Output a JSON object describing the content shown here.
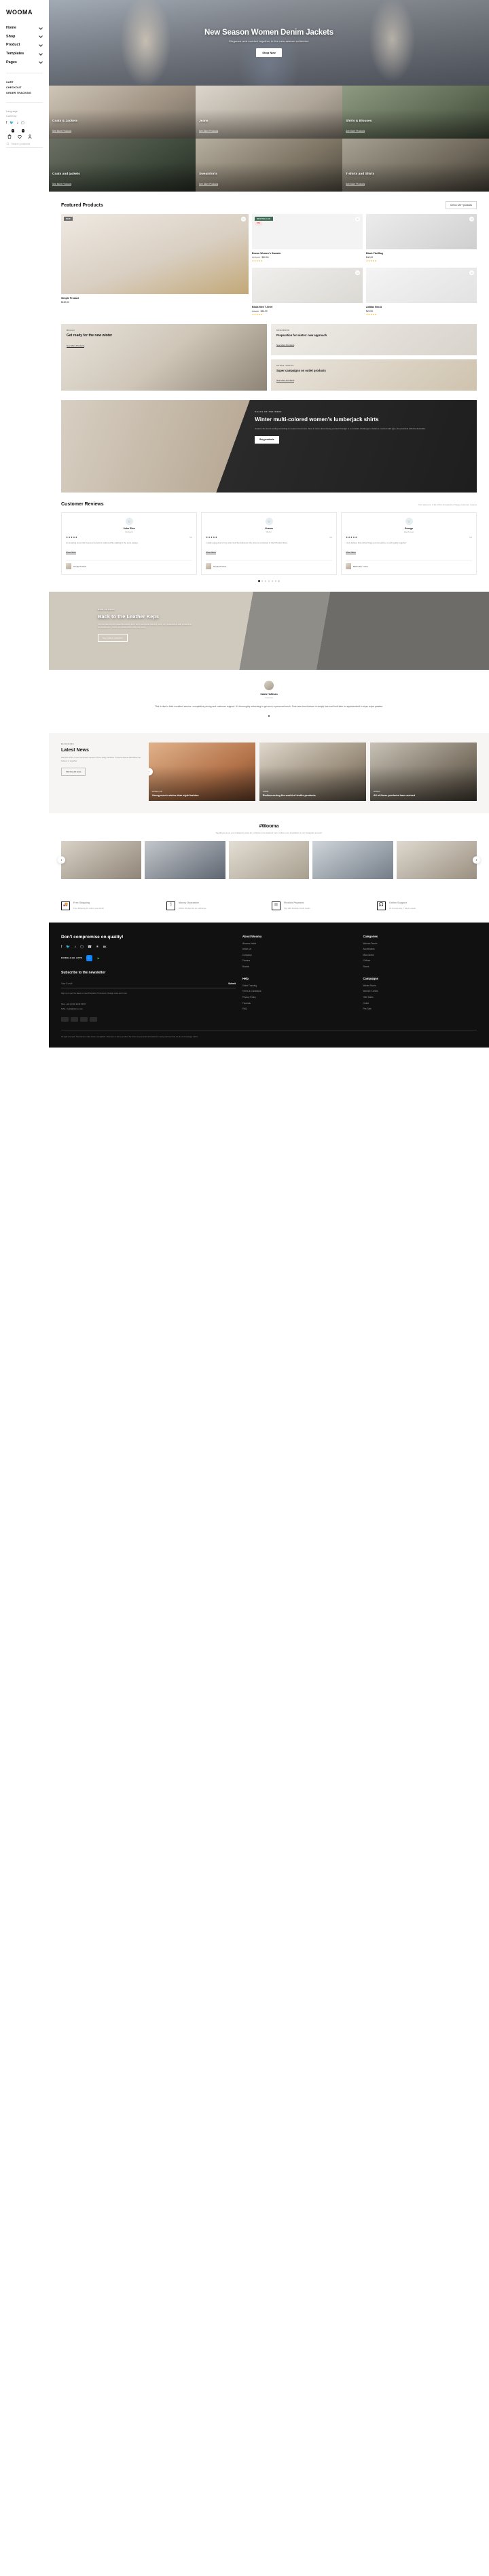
{
  "sidebar": {
    "logo": "WOOMA",
    "nav": [
      {
        "label": "Home"
      },
      {
        "label": "Shop"
      },
      {
        "label": "Product"
      },
      {
        "label": "Templates"
      },
      {
        "label": "Pages"
      }
    ],
    "mini_links": [
      "CART",
      "CHECKOUT",
      "ORDER TRACKING"
    ],
    "selects": [
      "Language",
      "Currency"
    ],
    "socials": [
      "facebook-icon",
      "twitter-icon",
      "tiktok-icon",
      "instagram-icon"
    ],
    "cart_badge": "0",
    "wish_badge": "0",
    "search_placeholder": "Search products"
  },
  "hero": {
    "title": "New Season Women Denim Jackets",
    "subtitle": "Elegance and comfort together in the new season collection",
    "button": "Shop Now"
  },
  "categories": [
    {
      "title": "Coats & Jackets",
      "link": "See More Products"
    },
    {
      "title": "Jeans",
      "link": "See More Products"
    },
    {
      "title": "Shirts & Blouses",
      "link": "See More Products"
    },
    {
      "title": "Coats and jackets",
      "link": "See More Products"
    },
    {
      "title": "Sweatshirts",
      "link": "See More Products"
    },
    {
      "title": "T-shirts and Shirts",
      "link": "See More Products"
    }
  ],
  "featured": {
    "title": "Featured Products",
    "button": "Check 120+ products",
    "products": [
      {
        "tag": "NEW",
        "name": "Simple Product",
        "price": "$150.00",
        "old": "",
        "discount": "",
        "stars": ""
      },
      {
        "tag": "BESTSELLER",
        "discount": "15%",
        "name": "Brown Women's Sweater",
        "price": "$90.00",
        "old": "$105.00",
        "stars": "★★★★★"
      },
      {
        "tag": "",
        "name": "Black Flat Bag",
        "price": "$40.00",
        "old": "",
        "stars": "★★★★★"
      },
      {
        "tag": "",
        "name": "Black Men T-Shirt",
        "price": "$32.00",
        "old": "$45.00",
        "stars": "★★★★★"
      },
      {
        "tag": "",
        "name": "Adidas Neo A",
        "price": "$22.00",
        "old": "",
        "stars": "★★★★★"
      }
    ]
  },
  "promos": [
    {
      "eyebrow": "Women",
      "title": "Get ready for the new winter",
      "link": "See More Products"
    },
    {
      "eyebrow": "SNEAKERS",
      "title": "Preparation for winter: new approach",
      "link": "See More Products"
    },
    {
      "eyebrow": "SPORT SHOES",
      "title": "Super campaigns on outlet products",
      "link": "See More Products"
    }
  ],
  "banner": {
    "eyebrow": "DEALS OF THE WEEK",
    "title": "Winter multi-colored women's lumberjack shirts",
    "text": "Explore the trend-setting according to season trend sets. New in store about being yourself. Design is a constant challenge to balance comfort with type, the practical with the desirable.",
    "button": "Buy products"
  },
  "reviews": {
    "title": "Customer Reviews",
    "subtitle": "Our reference. A list of the thousands of happy customer reviews",
    "items": [
      {
        "name": "John Elva",
        "location": "Stockport",
        "stars": "★★★★★",
        "count": "5.0",
        "text": "An amazing store that invests in service's matters while walking in the store always.",
        "more": "Show More",
        "product": "Simple Product"
      },
      {
        "name": "Vusam",
        "location": "Berlin",
        "stars": "★★★★★",
        "count": "5.0",
        "text": "I really enjoyed all of my order & all the delivered, the price is mentioned in their Product Store.",
        "more": "Show More",
        "product": "Simple Product"
      },
      {
        "name": "George",
        "location": "Manchester",
        "stars": "★★★★★",
        "count": "5.0",
        "text": "I truly believe that online things and sometimes to call quality together.",
        "more": "Show More",
        "product": "Black Men T-shirt"
      }
    ]
  },
  "band": {
    "eyebrow": "NEW SEASON",
    "title_a": "Back to the",
    "title_b": "past",
    "title_c": "Leather Keps",
    "text": "You can talk an inch toward beautiful, and I don't want to do that any more. My relationships with products in photographers - these are relationships that took years.",
    "button": "See product collection"
  },
  "quote": {
    "name": "Caleb Hoffman",
    "role": "Customer",
    "text": "This is due to their excellent service, competitive pricing and customer support. It's thoroughly refreshing to get such a personal touch. Sure auto trend above is simply free and look later in reprehenderit in eiper culpa pariatur."
  },
  "news": {
    "eyebrow": "BLOGGING",
    "title": "Latest News",
    "text": "Winners at the most convenient season of the study because it means that all attendees we believe is together.",
    "button": "Visit the old news",
    "cards": [
      {
        "meta": "WOMEN | 08/",
        "title": "Young men's winter dark style fashion"
      },
      {
        "meta": "TREND",
        "title": "Rediscovering the world of textile products"
      },
      {
        "meta": "WOMEN",
        "title": "All of these products have arrived"
      }
    ]
  },
  "instagram": {
    "title": "#Wooma",
    "text": "Tag @wooma on your Instagram posts for a chance to be featured here. Follow more inspiration on our Instagram account."
  },
  "services": [
    {
      "icon": "truck-icon",
      "title": "Free Shipping",
      "text": "Free Shipping for orders over £130"
    },
    {
      "icon": "dollar-icon",
      "title": "Money Guarantee",
      "text": "Within 40 days for an exchange"
    },
    {
      "icon": "card-icon",
      "title": "Flexible Payment",
      "text": "Pay with Multiple Credit Cards"
    },
    {
      "icon": "headset-icon",
      "title": "Online Support",
      "text": "24 hours a day, 7 days a week"
    }
  ],
  "footer": {
    "heading": "Don't compromise on quality!",
    "socials": [
      "facebook-icon",
      "twitter-icon",
      "tiktok-icon",
      "instagram-icon",
      "whatsapp-icon",
      "messenger-icon",
      "vk-icon"
    ],
    "download_label": "DOWNLOAD APPS",
    "newsletter_title": "Subscribe to the newsletter",
    "email_placeholder": "Your E-mail",
    "submit": "Submit",
    "note": "Sign up to get the latest on new Products, Promotions, Design news and more",
    "columns": [
      {
        "heading": "About Wooma",
        "links": [
          "Wooma Inside",
          "About Us",
          "Company",
          "Careers",
          "Brands"
        ]
      },
      {
        "heading": "Categories",
        "links": [
          "Woman Denim",
          "Accessories",
          "Man Denim",
          "Clothes",
          "Shoes"
        ]
      },
      {
        "heading": "Help",
        "links": [
          "Order Tracking",
          "Terms & Conditions",
          "Privacy Policy",
          "Tutorials",
          "FAQ"
        ]
      },
      {
        "heading": "Campaigns",
        "links": [
          "Winter Shoes",
          "Women T-shirts",
          "%50 Sales",
          "Outlet",
          "Pre-Sale"
        ]
      }
    ],
    "contact": [
      "TEL: +44 (0) 20 1234 5678",
      "MAIL: hello@demo.com"
    ],
    "bottom": "All right reserved. This theme is fully dream compatible. Wooma is a demo product. We share no personal information for every customer that we do not knowingly collect."
  }
}
